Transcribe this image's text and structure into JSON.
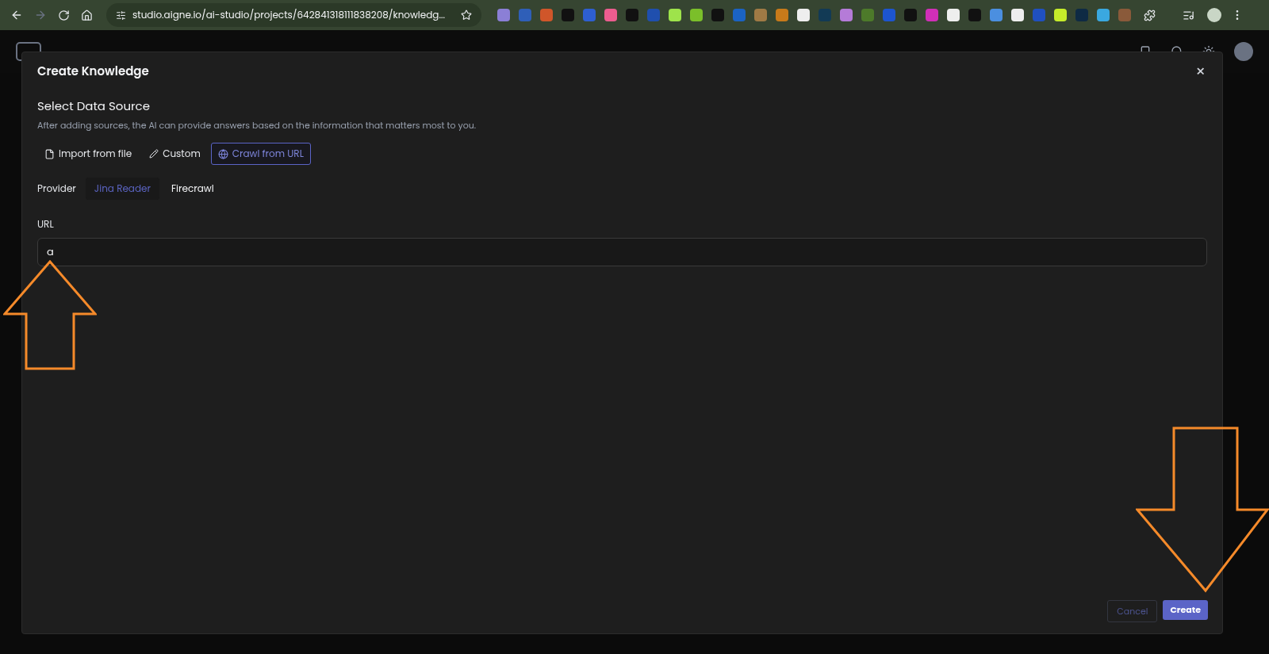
{
  "browser": {
    "url": "studio.aigne.io/ai-studio/projects/642841318111838208/knowledg..."
  },
  "dialog": {
    "title": "Create Knowledge",
    "close": "×",
    "heading": "Select Data Source",
    "description": "After adding sources, the AI can provide answers based on the information that matters most to you.",
    "sources": [
      {
        "label": "Import from file",
        "selected": false
      },
      {
        "label": "Custom",
        "selected": false
      },
      {
        "label": "Crawl from URL",
        "selected": true
      }
    ],
    "provider_label": "Provider",
    "providers": [
      {
        "label": "Jina Reader",
        "selected": true
      },
      {
        "label": "Firecrawl",
        "selected": false
      }
    ],
    "url_label": "URL",
    "url_value": "a",
    "buttons": [
      {
        "label": "Cancel",
        "kind": "outline"
      },
      {
        "label": "Create",
        "kind": "primary"
      }
    ]
  }
}
